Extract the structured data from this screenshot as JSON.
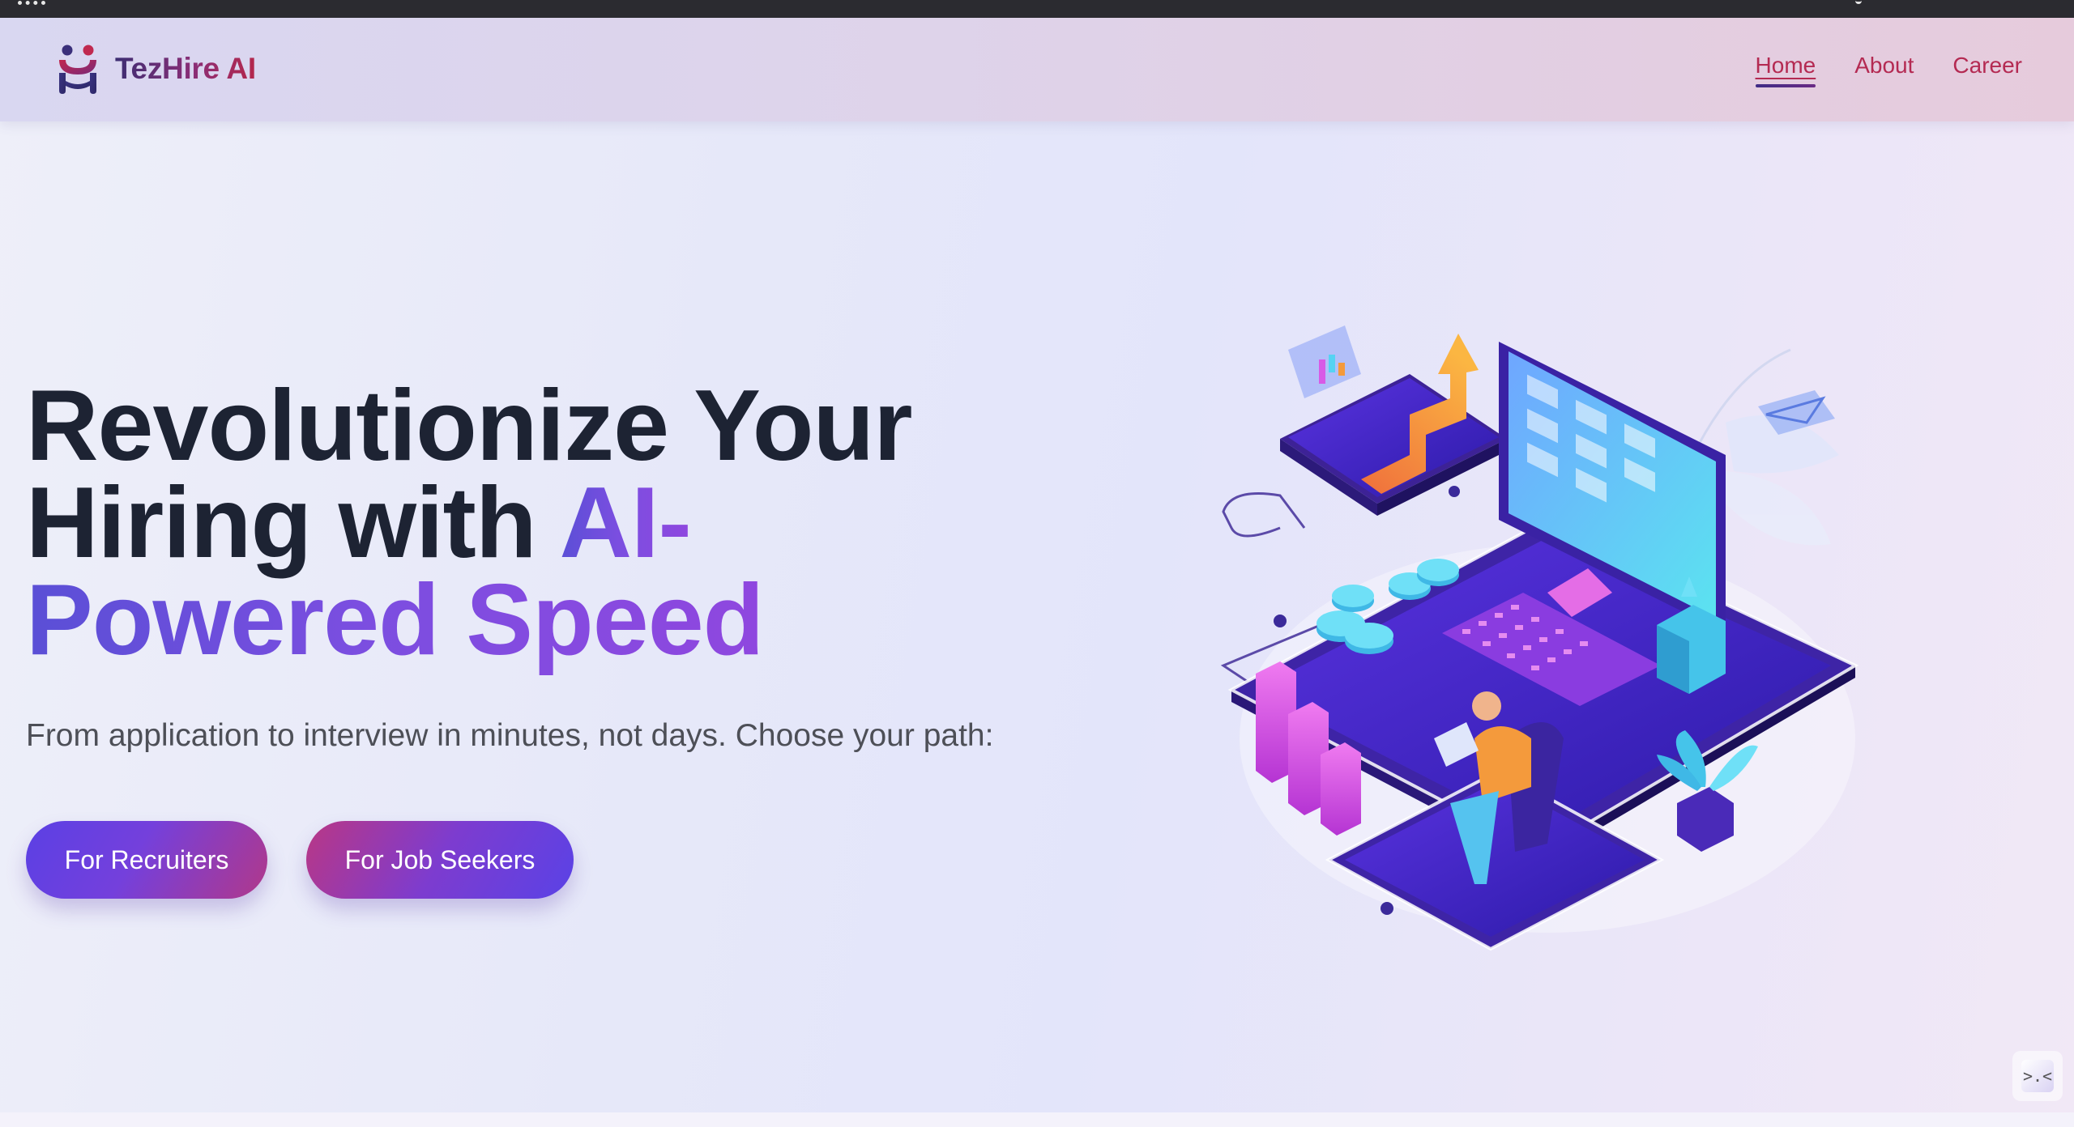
{
  "brand": {
    "name": "TezHire AI",
    "logo_icon": "tezhire-logo-icon",
    "colors": {
      "dark": "#3c2d72",
      "accent": "#b4284c"
    }
  },
  "nav": {
    "items": [
      {
        "label": "Home",
        "active": true
      },
      {
        "label": "About",
        "active": false
      },
      {
        "label": "Career",
        "active": false
      }
    ],
    "color": "#b42a52"
  },
  "hero": {
    "title_part1": "Revolutionize Your",
    "title_part2": "Hiring with ",
    "title_accent1": "AI-",
    "title_accent2": "Powered Speed",
    "subtitle": "From application to interview in minutes, not days. Choose your path:"
  },
  "cta": {
    "recruiters_label": "For Recruiters",
    "seekers_label": "For Job Seekers"
  },
  "illustration": {
    "icon": "isometric-workspace-illustration",
    "colors": {
      "purple": "#4b2ad0",
      "cyan": "#55d3f3",
      "orange": "#f49a3c",
      "pink": "#d957e6"
    }
  },
  "floating": {
    "icon": "expand-icon",
    "glyph": ">.<"
  }
}
